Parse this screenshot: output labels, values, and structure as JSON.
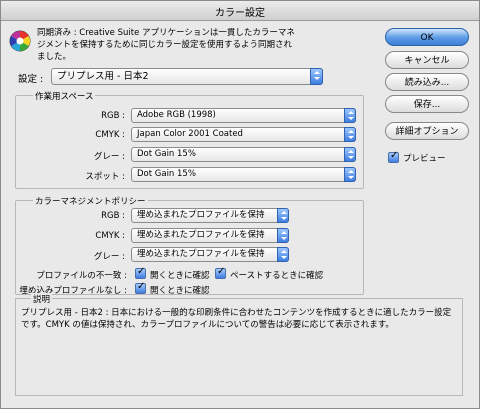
{
  "window": {
    "title": "カラー設定"
  },
  "sync": {
    "text": "同期済み : Creative Suite アプリケーションは一貫したカラーマネジメントを保持するために同じカラー設定を使用するよう同期されました。"
  },
  "settings": {
    "label": "設定 :",
    "value": "プリプレス用 - 日本2"
  },
  "working_spaces": {
    "title": "作業用スペース",
    "rows": [
      {
        "label": "RGB :",
        "value": "Adobe RGB (1998)"
      },
      {
        "label": "CMYK :",
        "value": "Japan Color 2001 Coated"
      },
      {
        "label": "グレー :",
        "value": "Dot Gain 15%"
      },
      {
        "label": "スポット :",
        "value": "Dot Gain 15%"
      }
    ]
  },
  "policies": {
    "title": "カラーマネジメントポリシー",
    "rows": [
      {
        "label": "RGB :",
        "value": "埋め込まれたプロファイルを保持"
      },
      {
        "label": "CMYK :",
        "value": "埋め込まれたプロファイルを保持"
      },
      {
        "label": "グレー :",
        "value": "埋め込まれたプロファイルを保持"
      }
    ],
    "mismatch_label": "プロファイルの不一致 :",
    "mismatch_open": "開くときに確認",
    "mismatch_paste": "ペーストするときに確認",
    "missing_label": "埋め込みプロファイルなし :",
    "missing_open": "開くときに確認"
  },
  "description": {
    "title": "説明",
    "text": "プリプレス用 - 日本2 : 日本における一般的な印刷条件に合わせたコンテンツを作成するときに適したカラー設定です。CMYK の値は保持され、カラープロファイルについての警告は必要に応じて表示されます。"
  },
  "buttons": {
    "ok": "OK",
    "cancel": "キャンセル",
    "load": "読み込み...",
    "save": "保存...",
    "advanced": "詳細オプション"
  },
  "preview": {
    "label": "プレビュー"
  }
}
